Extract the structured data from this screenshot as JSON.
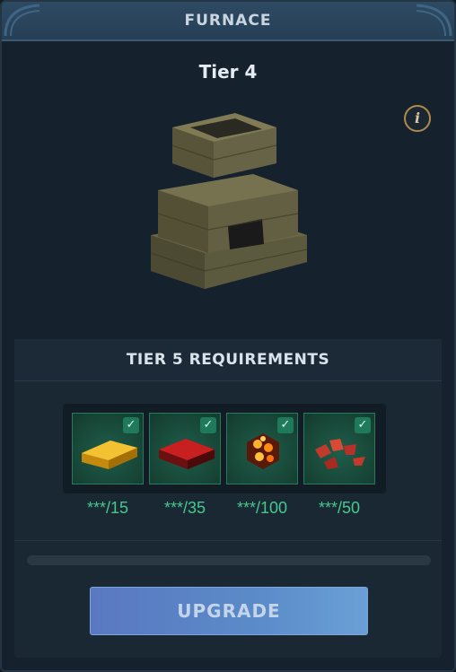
{
  "window": {
    "title": "FURNACE"
  },
  "building": {
    "tier_label": "Tier 4",
    "info_icon": "info-icon"
  },
  "requirements": {
    "title": "TIER 5 REQUIREMENTS",
    "items": [
      {
        "name": "gold-ingot",
        "count": "***/15",
        "met": true
      },
      {
        "name": "red-ingot",
        "count": "***/35",
        "met": true
      },
      {
        "name": "fire-ore",
        "count": "***/100",
        "met": true
      },
      {
        "name": "red-crystal-shards",
        "count": "***/50",
        "met": true
      }
    ],
    "progress": 0
  },
  "actions": {
    "upgrade_label": "UPGRADE"
  },
  "colors": {
    "accent_green": "#46c98d",
    "header_blue": "#2e4a63",
    "button_blue": "#5b8bc9"
  }
}
